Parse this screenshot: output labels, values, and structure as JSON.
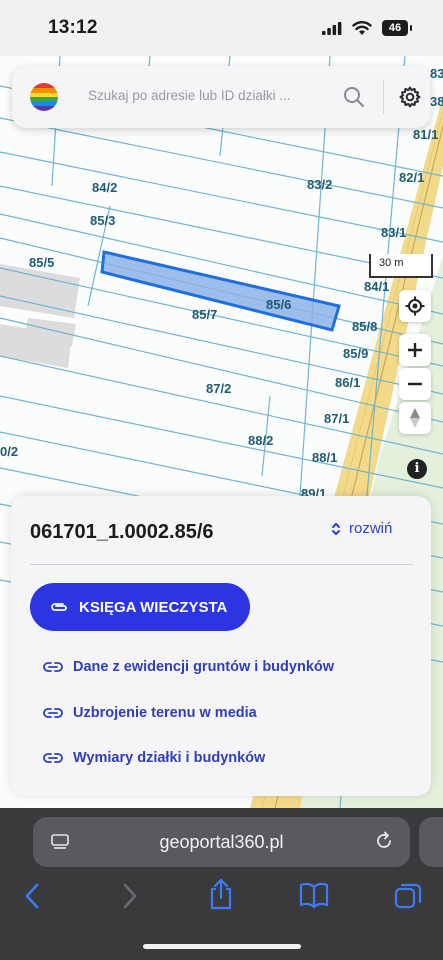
{
  "status_bar": {
    "time": "13:12",
    "battery": "46"
  },
  "search": {
    "placeholder": "Szukaj po adresie lub ID działki ..."
  },
  "map": {
    "scale_label": "30 m",
    "plot_labels": [
      "84/2",
      "83/2",
      "85/3",
      "85/5",
      "83/1",
      "84/1",
      "85/6",
      "85/7",
      "85/8",
      "85/9",
      "86/1",
      "87/2",
      "87/1",
      "88/2",
      "88/1",
      "89/1",
      "82/1",
      "81/1",
      "83",
      "38",
      "0/2"
    ],
    "highlight_color": "#1f6fe0"
  },
  "card": {
    "parcel_id": "061701_1.0002.85/6",
    "expand_label": "rozwiń",
    "primary_button": "KSIĘGA WIECZYSTA",
    "links": [
      "Dane z ewidencji gruntów i budynków",
      "Uzbrojenie terenu w media",
      "Wymiary działki i budynków"
    ]
  },
  "browser": {
    "domain": "geoportal360.pl"
  },
  "colors": {
    "accent": "#2b36e2",
    "link": "#2f3fb8",
    "parcel_line": "#6fb6d0",
    "road": "#f3d98a"
  }
}
